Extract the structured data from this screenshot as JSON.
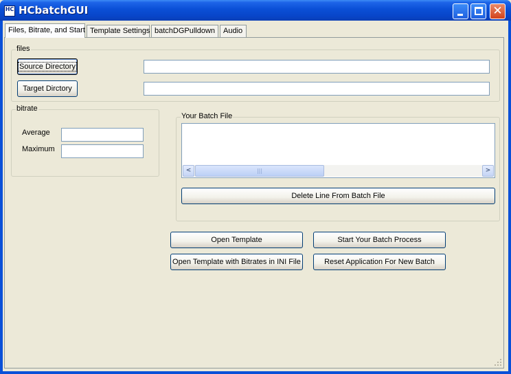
{
  "window": {
    "title": "HCbatchGUI",
    "icon_text": "HC"
  },
  "tabs": [
    {
      "label": "Files, Bitrate, and Start",
      "active": true
    },
    {
      "label": "Template Settings",
      "active": false
    },
    {
      "label": "batchDGPulldown",
      "active": false
    },
    {
      "label": "Audio",
      "active": false
    }
  ],
  "files": {
    "group_label": "files",
    "source_button": "Source Directory",
    "source_value": "",
    "target_button": "Target Dirctory",
    "target_value": ""
  },
  "bitrate": {
    "group_label": "bitrate",
    "average_label": "Average",
    "average_value": "",
    "maximum_label": "Maximum",
    "maximum_value": ""
  },
  "batch": {
    "group_label": "Your Batch File",
    "lines": [],
    "delete_button": "Delete Line From Batch File"
  },
  "actions": {
    "open_template": "Open Template",
    "open_template_ini": "Open Template with Bitrates in INI File",
    "start_batch": "Start Your Batch Process",
    "reset_app": "Reset Application For New Batch"
  },
  "icons": {
    "minimize": "minimize-icon",
    "maximize": "maximize-icon",
    "close": "close-icon",
    "scroll_left": "chevron-left-icon",
    "scroll_right": "chevron-right-icon"
  },
  "colors": {
    "titlebar": "#0a4fd6",
    "close_button": "#d4421a",
    "face": "#ece9d8"
  }
}
